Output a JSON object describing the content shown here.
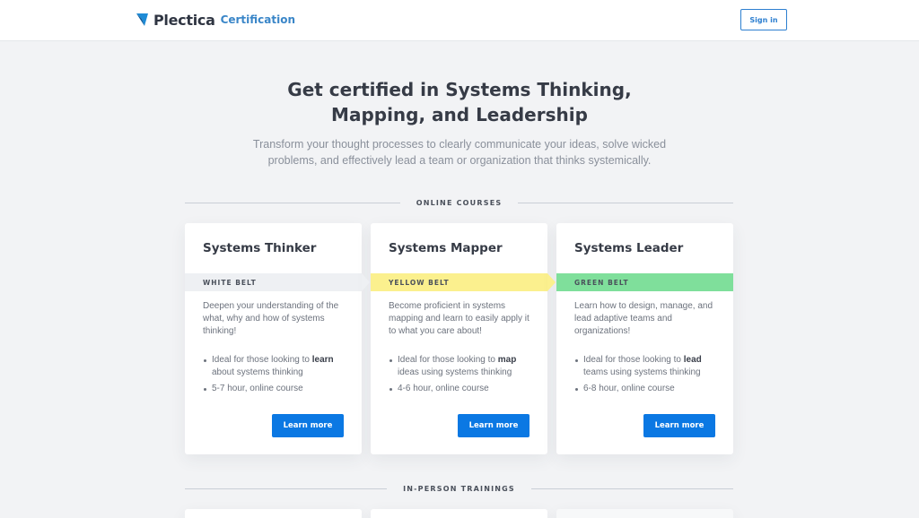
{
  "header": {
    "brand": "Plectica",
    "product": "Certification",
    "signin_label": "Sign in"
  },
  "hero": {
    "title": "Get certified in Systems Thinking, Mapping, and Leadership",
    "subtitle": "Transform your thought processes to clearly communicate your ideas, solve wicked problems, and effectively lead a team or organization that thinks systemically."
  },
  "sections": {
    "online": "ONLINE COURSES",
    "inperson": "IN-PERSON TRAININGS"
  },
  "courses": [
    {
      "title": "Systems Thinker",
      "belt": "WHITE BELT",
      "belt_color": "#eef0f3",
      "description": "Deepen your understanding of the what, why and how of systems thinking!",
      "bullet1_pre": "Ideal for those looking to ",
      "bullet1_bold": "learn",
      "bullet1_post": " about systems thinking",
      "bullet2": "5-7 hour, online course",
      "button": "Learn more"
    },
    {
      "title": "Systems Mapper",
      "belt": "YELLOW BELT",
      "belt_color": "#fbf08e",
      "description": "Become proficient in systems mapping and learn to easily apply it to what you care about!",
      "bullet1_pre": "Ideal for those looking to ",
      "bullet1_bold": "map",
      "bullet1_post": " ideas using systems thinking",
      "bullet2": "4-6 hour, online course",
      "button": "Learn more"
    },
    {
      "title": "Systems Leader",
      "belt": "GREEN BELT",
      "belt_color": "#7fdf9b",
      "description": "Learn how to design, manage, and lead adaptive teams and organizations!",
      "bullet1_pre": "Ideal for those looking to ",
      "bullet1_bold": "lead",
      "bullet1_post": " teams using systems thinking",
      "bullet2": "6-8 hour, online course",
      "button": "Learn more"
    }
  ],
  "colors": {
    "accent": "#0b78e3",
    "brand_blue": "#3a86c8"
  }
}
